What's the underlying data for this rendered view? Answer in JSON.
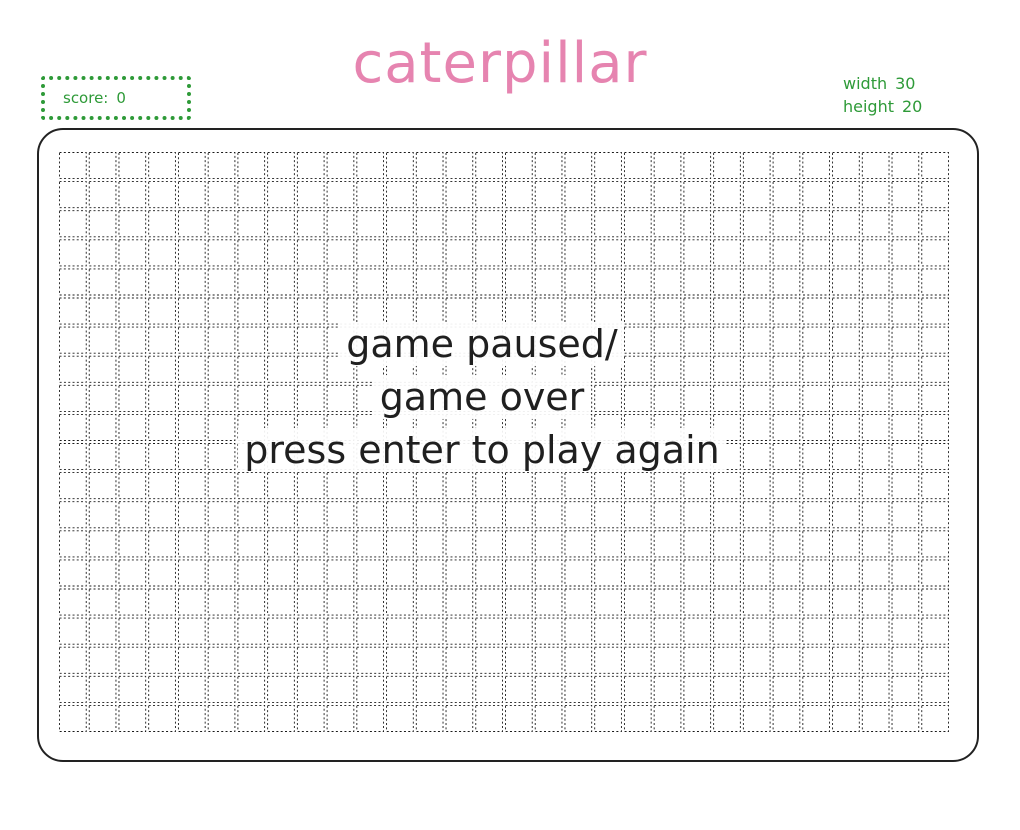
{
  "header": {
    "title": "caterpillar",
    "title_color": "#e684b0"
  },
  "score": {
    "label": "score:",
    "value": "0",
    "color": "#2e9a38"
  },
  "dimensions": {
    "width_label": "width",
    "width_value": "30",
    "height_label": "height",
    "height_value": "20",
    "color": "#2e9a38"
  },
  "board": {
    "columns": 30,
    "rows": 20
  },
  "overlay": {
    "line1": "game paused/",
    "line2": "game over",
    "line3": "press enter to play again"
  }
}
